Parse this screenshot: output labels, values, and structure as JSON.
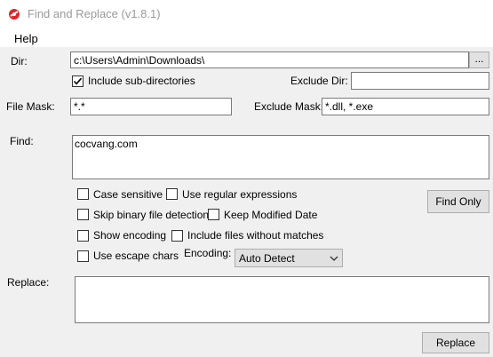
{
  "window": {
    "title": "Find and Replace (v1.8.1)",
    "icon": "red-circle-app-icon"
  },
  "menu": {
    "help": "Help"
  },
  "dir": {
    "label": "Dir:",
    "value": "c:\\Users\\Admin\\Downloads\\",
    "browse_label": "..."
  },
  "include_subdirs": {
    "label": "Include sub-directories",
    "checked": true
  },
  "exclude_dir": {
    "label": "Exclude Dir:",
    "value": ""
  },
  "file_mask": {
    "label": "File Mask:",
    "value": "*.*"
  },
  "exclude_mask": {
    "label": "Exclude Mask:",
    "value": "*.dll, *.exe"
  },
  "find": {
    "label": "Find:",
    "value": "cocvang.com"
  },
  "options": {
    "case_sensitive": "Case sensitive",
    "use_regex": "Use regular expressions",
    "skip_binary": "Skip binary file detection",
    "keep_modified_date": "Keep Modified Date",
    "show_encoding": "Show encoding",
    "include_no_matches": "Include files without matches",
    "use_escape_chars": "Use escape chars"
  },
  "encoding": {
    "label": "Encoding:",
    "selected": "Auto Detect"
  },
  "buttons": {
    "find_only": "Find Only",
    "replace": "Replace"
  },
  "replace": {
    "label": "Replace:",
    "value": ""
  },
  "colors": {
    "background": "#f0f0f0",
    "titlebar": "#ffffff",
    "icon_red": "#e0262b"
  }
}
